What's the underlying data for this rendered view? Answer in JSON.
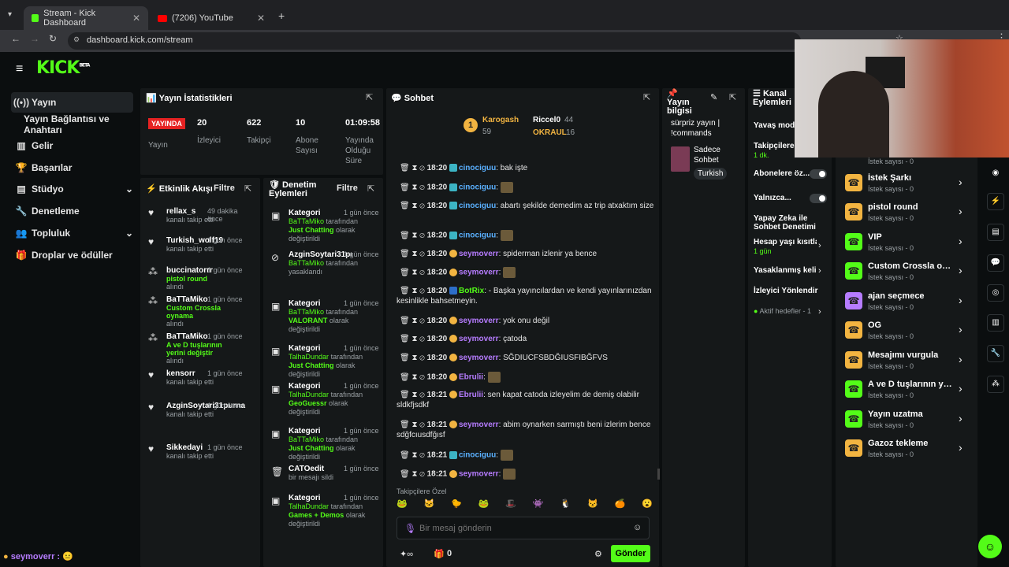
{
  "browser": {
    "tabs": [
      {
        "title": "Stream - Kick Dashboard"
      },
      {
        "title": "(7206) YouTube"
      }
    ],
    "url": "dashboard.kick.com/stream"
  },
  "app": {
    "logo": "KICK",
    "logo_beta": "BETA"
  },
  "sidebar": {
    "items": [
      {
        "label": "Yayın",
        "icon": "broadcast-icon"
      },
      {
        "label": "Yayın Bağlantısı ve Anahtarı",
        "icon": ""
      },
      {
        "label": "Gelir",
        "icon": "chart-icon"
      },
      {
        "label": "Başarılar",
        "icon": "trophy-icon"
      },
      {
        "label": "Stüdyo",
        "icon": "studio-icon"
      },
      {
        "label": "Denetleme",
        "icon": "wrench-icon"
      },
      {
        "label": "Topluluk",
        "icon": "community-icon"
      },
      {
        "label": "Droplar ve ödüller",
        "icon": "gift-icon"
      }
    ]
  },
  "stats": {
    "title": "Yayın İstatistikleri",
    "live_badge": "YAYINDA",
    "live_label": "Yayın",
    "viewers": {
      "value": "20",
      "label": "İzleyici"
    },
    "followers": {
      "value": "622",
      "label": "Takipçi"
    },
    "subs": {
      "value": "10",
      "label": "Abone Sayısı"
    },
    "uptime": {
      "value": "01:09:58",
      "label": "Yayında Olduğu Süre"
    }
  },
  "activity": {
    "title": "Etkinlik Akışı",
    "filter": "Filtre",
    "items": [
      {
        "name": "rellax_s",
        "time": "49 dakika önce",
        "sub": "kanalı takip etti",
        "highlight": ""
      },
      {
        "name": "Turkish_wolf19",
        "time": "1 gün önce",
        "sub": "kanalı takip etti",
        "highlight": ""
      },
      {
        "name": "buccinatorrr",
        "time": "1 gün önce",
        "sub": "alındı",
        "highlight": "pistol round"
      },
      {
        "name": "BaTTaMiko",
        "time": "1 gün önce",
        "sub": "alındı",
        "highlight": "Custom Crossla oynama"
      },
      {
        "name": "BaTTaMiko",
        "time": "1 gün önce",
        "sub": "alındı",
        "highlight": "A ve D tuşlarının yerini değiştir"
      },
      {
        "name": "kensorr",
        "time": "1 gün önce",
        "sub": "kanalı takip etti",
        "highlight": ""
      },
      {
        "name": "AzginSoytari31purna",
        "time": "1 gün önce",
        "sub": "kanalı takip etti",
        "highlight": ""
      },
      {
        "name": "Sikkedayi",
        "time": "1 gün önce",
        "sub": "kanalı takip etti",
        "highlight": ""
      }
    ]
  },
  "moderation": {
    "title": "Denetim Eylemleri",
    "filter": "Filtre",
    "items": [
      {
        "title": "Kategori",
        "time": "1 gün önce",
        "who": "BaTTaMiko",
        "mid": "tarafından",
        "hl": "Just Chatting",
        "rest": "olarak değiştirildi"
      },
      {
        "title": "AzginSoytari31purna",
        "time": "1 gün önce",
        "who": "BaTTaMiko",
        "mid": "tarafından",
        "hl": "",
        "rest": "yasaklandı"
      },
      {
        "title": "Kategori",
        "time": "1 gün önce",
        "who": "BaTTaMiko",
        "mid": "tarafından",
        "hl": "VALORANT",
        "rest": "olarak değiştirildi"
      },
      {
        "title": "Kategori",
        "time": "1 gün önce",
        "who": "TalhaDundar",
        "mid": "tarafından",
        "hl": "Just Chatting",
        "rest": "olarak değiştirildi"
      },
      {
        "title": "Kategori",
        "time": "1 gün önce",
        "who": "TalhaDundar",
        "mid": "tarafından",
        "hl": "GeoGuessr",
        "rest": "olarak değiştirildi"
      },
      {
        "title": "Kategori",
        "time": "1 gün önce",
        "who": "BaTTaMiko",
        "mid": "tarafından",
        "hl": "Just Chatting",
        "rest": "olarak değiştirildi"
      },
      {
        "title": "CATOedit",
        "time": "1 gün önce",
        "who": "",
        "mid": "",
        "hl": "",
        "rest": "bir mesajı sildi"
      },
      {
        "title": "Kategori",
        "time": "1 gün önce",
        "who": "TalhaDundar",
        "mid": "tarafından",
        "hl": "Games + Demos",
        "rest": "olarak değiştirildi"
      }
    ]
  },
  "chat": {
    "title": "Sohbet",
    "top": [
      {
        "name": "Karogash",
        "count": "59"
      },
      {
        "name": "Riccel0",
        "count": "44"
      },
      {
        "name": "OKRAUL",
        "count": "16"
      }
    ],
    "messages": [
      {
        "time": "18:20",
        "user": "cinociguu",
        "color": "#5ab0ff",
        "text": "bak işte"
      },
      {
        "time": "18:20",
        "user": "cinociguu",
        "color": "#5ab0ff",
        "text": ""
      },
      {
        "time": "18:20",
        "user": "cinociguu",
        "color": "#5ab0ff",
        "text": "abartı şekilde demedim az trip atxaktım size"
      },
      {
        "time": "18:20",
        "user": "cinociguu",
        "color": "#5ab0ff",
        "text": ""
      },
      {
        "time": "18:20",
        "user": "seymoverr",
        "color": "#b67cff",
        "text": "spiderman izlenir ya bence"
      },
      {
        "time": "18:20",
        "user": "seymoverr",
        "color": "#b67cff",
        "text": ""
      },
      {
        "time": "18:20",
        "user": "BotRix",
        "color": "#53fc18",
        "text": "- Başka yayıncılardan ve kendi yayınlarınızdan kesinlikle bahsetmeyin."
      },
      {
        "time": "18:20",
        "user": "seymoverr",
        "color": "#b67cff",
        "text": "yok onu değil"
      },
      {
        "time": "18:20",
        "user": "seymoverr",
        "color": "#b67cff",
        "text": "çatoda"
      },
      {
        "time": "18:20",
        "user": "seymoverr",
        "color": "#b67cff",
        "text": "SĞDIUCFSBDĞIUSFIBĞFVS"
      },
      {
        "time": "18:20",
        "user": "Ebrulii",
        "color": "#b67cff",
        "text": ""
      },
      {
        "time": "18:21",
        "user": "Ebrulii",
        "color": "#b67cff",
        "text": "sen kapat catoda izleyelim de demiş olabilir sldkfjsdkf"
      },
      {
        "time": "18:21",
        "user": "seymoverr",
        "color": "#b67cff",
        "text": "abim oynarken sarmıştı beni izlerim bence sdğfcıusdfğısf"
      },
      {
        "time": "18:21",
        "user": "cinociguu",
        "color": "#5ab0ff",
        "text": ""
      },
      {
        "time": "18:21",
        "user": "seymoverr",
        "color": "#b67cff",
        "text": ""
      }
    ],
    "follower_emotes": "Takipçilere Özel",
    "placeholder": "Bir mesaj gönderin",
    "count": "0",
    "send": "Gönder"
  },
  "stream_info": {
    "title": "Yayın bilgisi",
    "stream_title": "sürpriz yayın | !commands",
    "category": "Sadece Sohbet",
    "tag": "Turkish"
  },
  "channel_actions": {
    "title": "Kanal Eylemleri",
    "items": [
      {
        "label": "Yavaş mod"
      },
      {
        "label": "Takipçilere",
        "sub": "1 dk."
      },
      {
        "label": "Abonelere öz..."
      },
      {
        "label": "Yalnızca..."
      },
      {
        "label": "Yapay Zeka ile Sohbet Denetimi"
      },
      {
        "label": "Hesap yaşı kısıtla",
        "sub": "1 gün"
      },
      {
        "label": "Yasaklanmış keli"
      },
      {
        "label": "İzleyici Yönlendir"
      },
      {
        "label": "Aktif hedefler - 1"
      }
    ]
  },
  "rewards": {
    "items": [
      {
        "title": "İstek Şarkı",
        "sub": "İstek sayısı - 0",
        "color": "#f2b441"
      },
      {
        "title": "pistol round",
        "sub": "İstek sayısı - 0",
        "color": "#f2b441"
      },
      {
        "title": "VIP",
        "sub": "İstek sayısı - 0",
        "color": "#53fc18"
      },
      {
        "title": "Custom Crossla oyna...",
        "sub": "İstek sayısı - 0",
        "color": "#53fc18"
      },
      {
        "title": "ajan seçmece",
        "sub": "İstek sayısı - 0",
        "color": "#b67cff"
      },
      {
        "title": "OG",
        "sub": "İstek sayısı - 0",
        "color": "#f2b441"
      },
      {
        "title": "Mesajımı vurgula",
        "sub": "İstek sayısı - 0",
        "color": "#f2b441"
      },
      {
        "title": "A ve D tuşlarının yeri...",
        "sub": "İstek sayısı - 0",
        "color": "#53fc18"
      },
      {
        "title": "Yayın uzatma",
        "sub": "İstek sayısı - 0",
        "color": "#53fc18"
      },
      {
        "title": "Gazoz tekleme",
        "sub": "İstek sayısı - 0",
        "color": "#f2b441"
      }
    ],
    "top_sub": "İstek sayısı - 0"
  },
  "overlay": {
    "bottom_user": "seymoverr :"
  }
}
